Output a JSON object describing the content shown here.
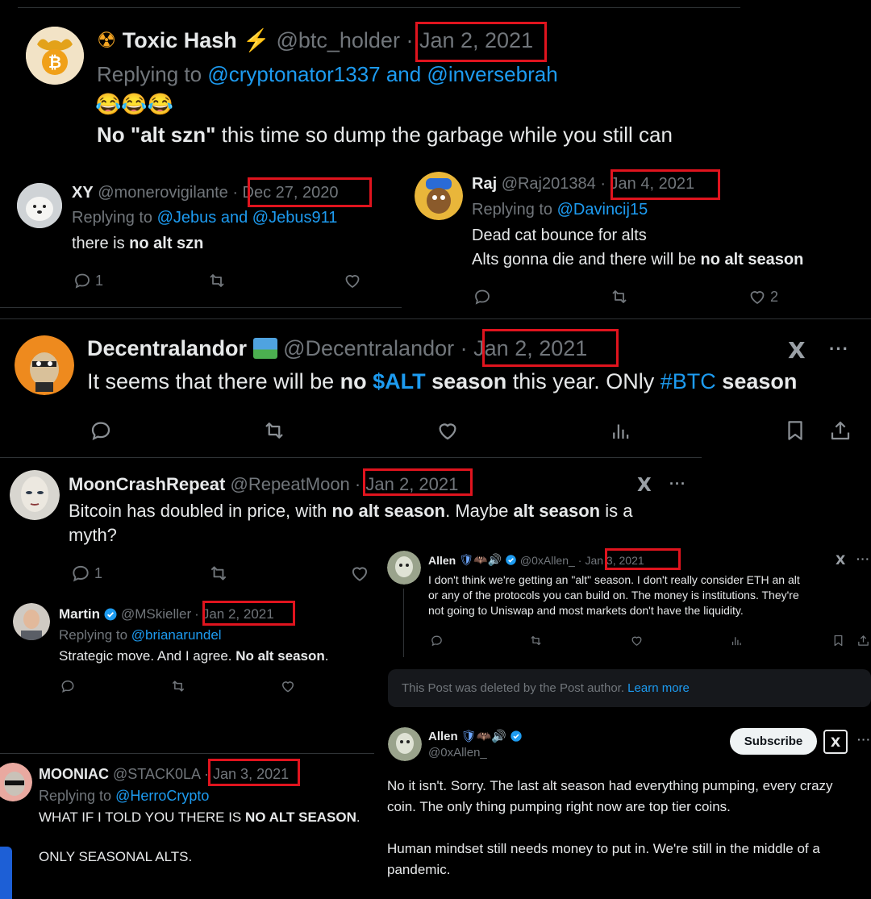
{
  "toxic": {
    "emoji": "☢",
    "name": "Toxic Hash",
    "bolt": "⚡",
    "handle": "@btc_holder",
    "sep": "·",
    "date": "Jan 2, 2021",
    "replying_prefix": "Replying to",
    "replying_to": "@cryptonator1337 and @inversebrah",
    "emojis": "😂😂😂",
    "text_bold": "No \"alt szn\"",
    "text_rest": " this time so dump the garbage while you still can"
  },
  "xy": {
    "name": "XY",
    "handle": "@monerovigilante",
    "sep": "·",
    "date": "Dec 27, 2020",
    "replying_prefix": "Replying to",
    "replying_to": "@Jebus and @Jebus911",
    "text_a": "there is ",
    "text_b": "no alt szn",
    "reply_count": "1"
  },
  "raj": {
    "name": "Raj",
    "handle": "@Raj201384",
    "sep": "·",
    "date": "Jan 4, 2021",
    "replying_prefix": "Replying to",
    "replying_to": "@Davincij15",
    "line1": "Dead cat bounce for alts",
    "line2_a": "Alts gonna die and there will be ",
    "line2_b": "no alt season",
    "like_count": "2"
  },
  "decentral": {
    "name": "Decentralandor",
    "handle": "@Decentralandor",
    "sep": "·",
    "date": "Jan 2, 2021",
    "t1": "It seems that there will be ",
    "t2": "no ",
    "t3": "$ALT",
    "t4": " season",
    "t5": " this year. ONly ",
    "t6": "#BTC",
    "t7": " season"
  },
  "moon": {
    "name": "MoonCrashRepeat",
    "handle": "@RepeatMoon",
    "sep": "·",
    "date": "Jan 2, 2021",
    "t1": "Bitcoin has doubled in price, with ",
    "t2": "no alt season",
    "t3": ". Maybe ",
    "t4": "alt season",
    "t5": " is a",
    "t6": "myth?",
    "reply_count": "1"
  },
  "martin": {
    "name": "Martin",
    "handle": "@MSkieller",
    "sep": "·",
    "date": "Jan 2, 2021",
    "replying_prefix": "Replying to",
    "replying_to": "@brianarundel",
    "text_a": "Strategic move. And I agree. ",
    "text_b": "No alt season",
    "text_c": "."
  },
  "allen1": {
    "name": "Allen",
    "badges": "🛡🦇🔊",
    "handle": "@0xAllen_",
    "sep": "·",
    "date": "Jan 3, 2021",
    "l1": "I don't think we're getting an \"alt\" season. I don't really consider ETH an alt",
    "l2": "or any of the protocols you can build on. The money is institutions. They're",
    "l3": "not going to Uniswap and most markets don't have the liquidity."
  },
  "deleted": {
    "text": "This Post was deleted by the Post author.",
    "link": "Learn more"
  },
  "allen2": {
    "name": "Allen",
    "badges": "🛡🦇🔊",
    "handle": "@0xAllen_",
    "subscribe": "Subscribe",
    "p1_l1": "No it isn't. Sorry. The last alt season had everything pumping, every crazy",
    "p1_l2": "coin. The only thing pumping right now are top tier coins.",
    "p2_l1": "Human mindset still needs money to put in. We're still in the middle of a",
    "p2_l2": "pandemic."
  },
  "mooniac": {
    "name": "MOONIAC",
    "handle": "@STACK0LA",
    "sep": "·",
    "date": "Jan 3, 2021",
    "replying_prefix": "Replying to",
    "replying_to": "@HerroCrypto",
    "l1_a": "WHAT IF I TOLD YOU THERE IS ",
    "l1_b": "NO ALT SEASON",
    "l1_c": ".",
    "l2": "ONLY SEASONAL ALTS."
  },
  "icons": {
    "x_logo": "x-logo",
    "more": "···",
    "reply": "reply-icon",
    "retweet": "retweet-icon",
    "like": "like-icon",
    "views": "views-icon",
    "bookmark": "bookmark-icon",
    "share": "share-icon"
  },
  "colors": {
    "background": "#000000",
    "text": "#e7e9ea",
    "muted": "#71767b",
    "link": "#1d9bf0",
    "highlight_box": "#e0141e"
  }
}
